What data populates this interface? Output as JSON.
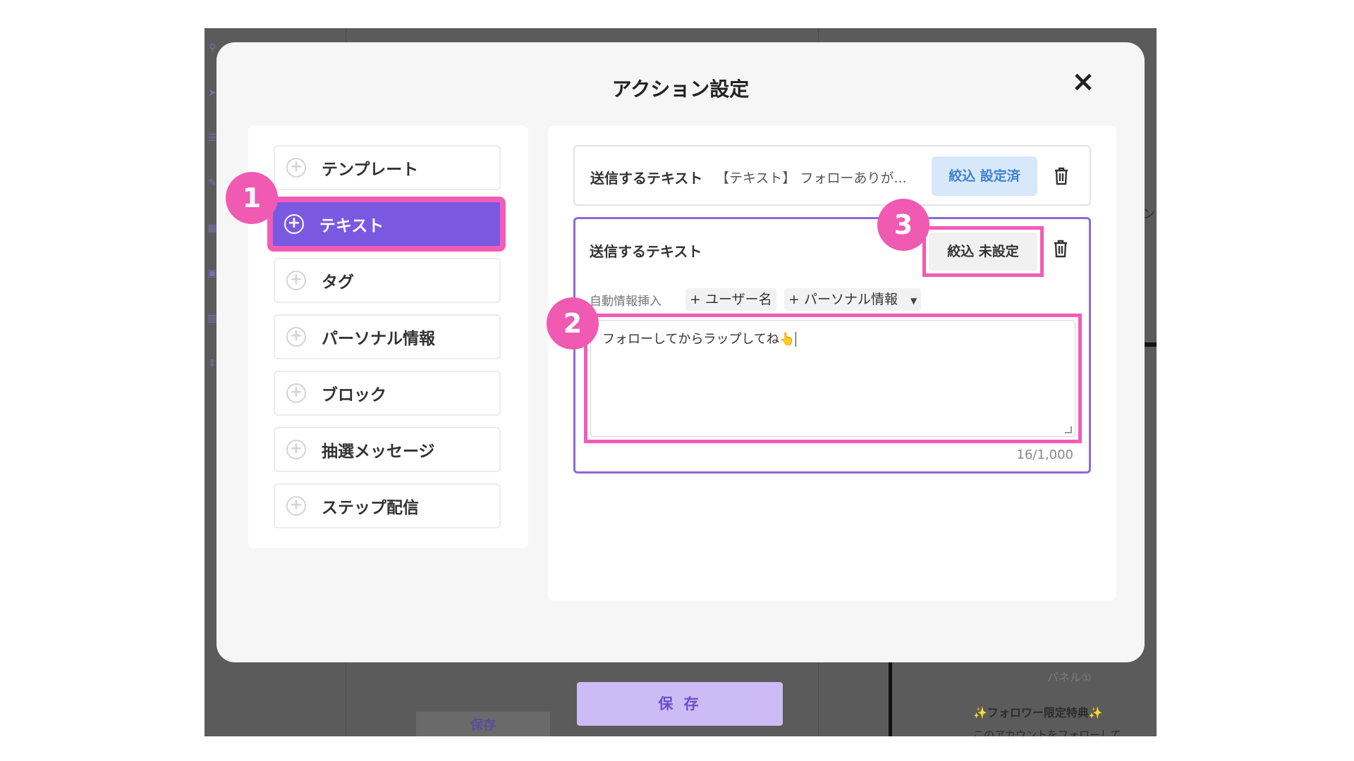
{
  "background": {
    "footer_save": "保存",
    "panel_label": "パネル①",
    "follower_title": "✨フォロワー限定特典✨",
    "follower_text": "このアカウントをフォローして",
    "right_edge_char": "ン"
  },
  "modal": {
    "title": "アクション設定",
    "close_icon": "×"
  },
  "actions": [
    {
      "label": "テンプレート",
      "icon": "plus-circle-icon"
    },
    {
      "label": "テキスト",
      "icon": "plus-circle-icon"
    },
    {
      "label": "タグ",
      "icon": "plus-circle-icon"
    },
    {
      "label": "パーソナル情報",
      "icon": "plus-circle-icon"
    },
    {
      "label": "ブロック",
      "icon": "plus-circle-icon"
    },
    {
      "label": "抽選メッセージ",
      "icon": "plus-circle-icon"
    },
    {
      "label": "ステップ配信",
      "icon": "plus-circle-icon"
    }
  ],
  "plus_glyph": "+",
  "messages": {
    "first": {
      "type": "送信するテキスト",
      "preview": "【テキスト】 フォローありが...",
      "filter_label": "絞込 設定済"
    },
    "second": {
      "type": "送信するテキスト",
      "filter_label": "絞込 未設定",
      "auto_insert_label": "自動情報挿入",
      "chip_user": "+ ユーザー名",
      "chip_personal": "+ パーソナル情報",
      "chip_caret": "▼",
      "text_value": "フォローしてからラップしてね👆",
      "char_count": "16/1,000"
    }
  },
  "badges": [
    "1",
    "2",
    "3"
  ],
  "save_button": "保 存",
  "colors": {
    "accent_purple": "#7a59e0",
    "highlight_pink": "#f25bb6",
    "filter_set_blue": "#3e82cf",
    "save_button_bg": "#cdbbf5"
  }
}
